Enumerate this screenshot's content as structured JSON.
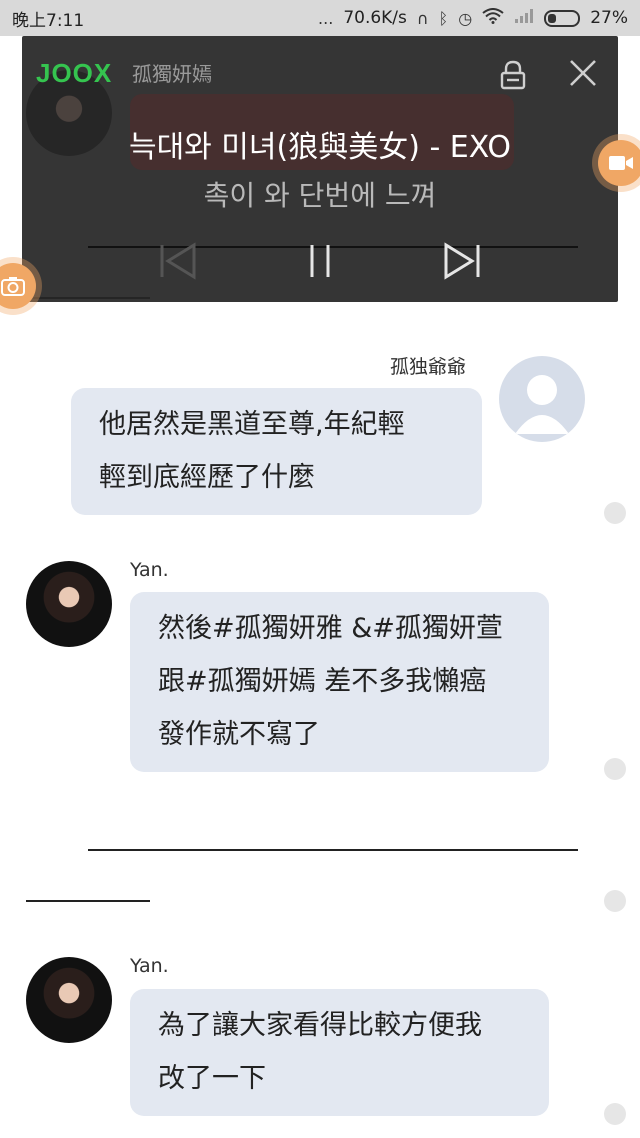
{
  "status_bar": {
    "time": "晚上7:11",
    "dots": "...",
    "speed": "70.6K/s",
    "battery_pct": "27%"
  },
  "lyrics_overlay": {
    "logo": "JOOX",
    "chat_name_behind": "孤獨妍嫣",
    "song_title": "늑대와 미녀(狼與美女) - EXO",
    "lyric": "촉이 와 단번에 느껴",
    "icons": [
      "lock-icon",
      "close-icon",
      "previous-icon",
      "pause-icon",
      "next-icon"
    ]
  },
  "messages": [
    {
      "sender": "孤独爺爺",
      "side": "right",
      "lines": [
        "他居然是黑道至尊,年紀輕",
        "輕到底經歷了什麼"
      ]
    },
    {
      "sender": "Yan.",
      "side": "left",
      "lines": [
        "然後#孤獨妍雅 &#孤獨妍萱",
        "跟#孤獨妍嫣 差不多我懶癌",
        "發作就不寫了"
      ]
    },
    {
      "sender": "Yan.",
      "side": "left",
      "lines": [
        "為了讓大家看得比較方便我",
        "改了一下"
      ]
    }
  ],
  "colors": {
    "bubble": "#e3e8f1",
    "overlay": "#262626",
    "joox_green": "#35c44f",
    "float_button": "#f0a765"
  }
}
